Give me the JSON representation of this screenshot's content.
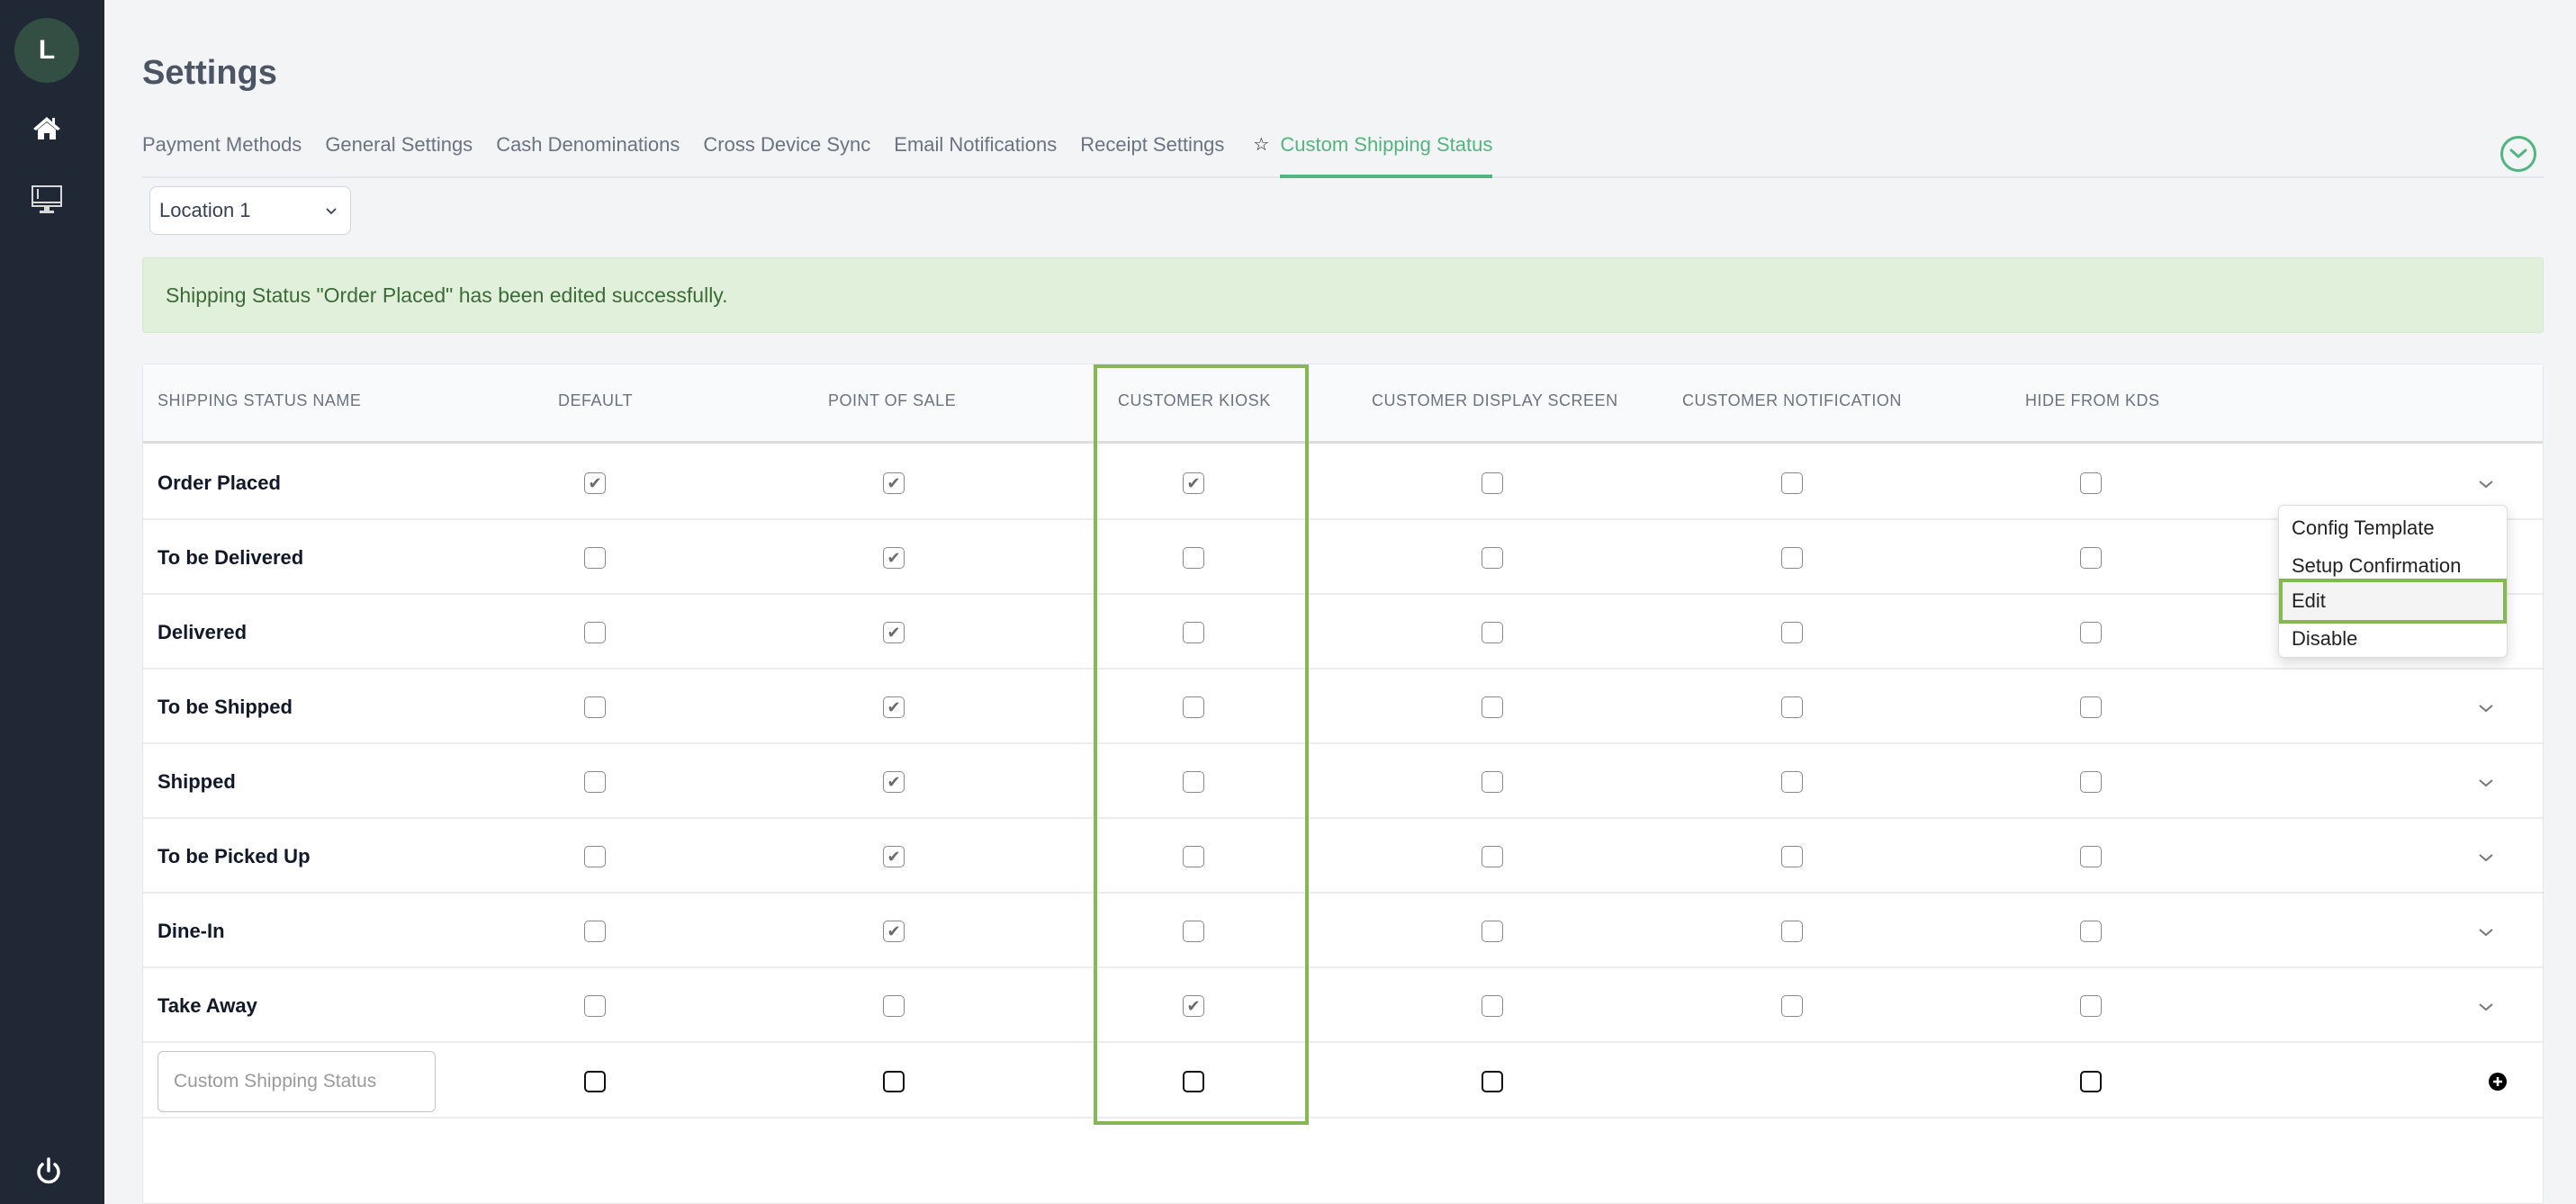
{
  "sidebar": {
    "avatar_initial": "L",
    "items": [
      {
        "name": "home",
        "icon": "home-icon"
      },
      {
        "name": "devices",
        "icon": "monitor-icon"
      },
      {
        "name": "logout",
        "icon": "power-icon"
      }
    ]
  },
  "header": {
    "title": "Settings"
  },
  "tabs": [
    {
      "label": "Payment Methods",
      "active": false
    },
    {
      "label": "General Settings",
      "active": false
    },
    {
      "label": "Cash Denominations",
      "active": false
    },
    {
      "label": "Cross Device Sync",
      "active": false
    },
    {
      "label": "Email Notifications",
      "active": false
    },
    {
      "label": "Receipt Settings",
      "active": false
    },
    {
      "label": "Custom Shipping Status",
      "active": true,
      "icon": "star-icon"
    }
  ],
  "location_select": {
    "value": "Location 1"
  },
  "alert": {
    "message": "Shipping Status \"Order Placed\" has been edited successfully."
  },
  "table": {
    "columns": [
      "SHIPPING STATUS NAME",
      "DEFAULT",
      "POINT OF SALE",
      "CUSTOMER KIOSK",
      "CUSTOMER DISPLAY SCREEN",
      "CUSTOMER NOTIFICATION",
      "HIDE FROM KDS"
    ],
    "rows": [
      {
        "name": "Order Placed",
        "default": true,
        "pos": true,
        "kiosk": true,
        "display": false,
        "notification": false,
        "hide_kds": false
      },
      {
        "name": "To be Delivered",
        "default": false,
        "pos": true,
        "kiosk": false,
        "display": false,
        "notification": false,
        "hide_kds": false
      },
      {
        "name": "Delivered",
        "default": false,
        "pos": true,
        "kiosk": false,
        "display": false,
        "notification": false,
        "hide_kds": false
      },
      {
        "name": "To be Shipped",
        "default": false,
        "pos": true,
        "kiosk": false,
        "display": false,
        "notification": false,
        "hide_kds": false
      },
      {
        "name": "Shipped",
        "default": false,
        "pos": true,
        "kiosk": false,
        "display": false,
        "notification": false,
        "hide_kds": false
      },
      {
        "name": "To be Picked Up",
        "default": false,
        "pos": true,
        "kiosk": false,
        "display": false,
        "notification": false,
        "hide_kds": false
      },
      {
        "name": "Dine-In",
        "default": false,
        "pos": true,
        "kiosk": false,
        "display": false,
        "notification": false,
        "hide_kds": false
      },
      {
        "name": "Take Away",
        "default": false,
        "pos": false,
        "kiosk": true,
        "display": false,
        "notification": false,
        "hide_kds": false
      }
    ],
    "new_row": {
      "placeholder": "Custom Shipping Status",
      "value": "",
      "default": false,
      "pos": false,
      "kiosk": false,
      "display": false,
      "hide_kds": false
    }
  },
  "context_menu": {
    "items": [
      {
        "label": "Config Template",
        "highlighted": false
      },
      {
        "label": "Setup Confirmation",
        "highlighted": false
      },
      {
        "label": "Edit",
        "highlighted": true
      },
      {
        "label": "Disable",
        "highlighted": false
      }
    ]
  },
  "colors": {
    "accent": "#52b47e",
    "highlight_border": "#86b852",
    "sidebar_bg": "#202735",
    "alert_bg": "#e1f0da",
    "alert_text": "#3c6b38"
  }
}
